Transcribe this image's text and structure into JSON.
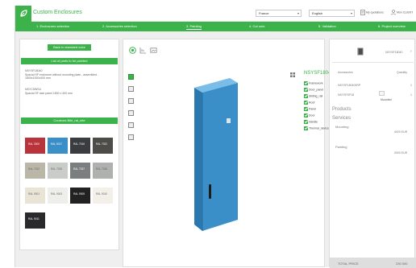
{
  "header": {
    "title": "Custom Enclosures",
    "country": "France",
    "language": "English",
    "quotations": "My quotations",
    "user": "Mon CLIENT"
  },
  "steps": [
    {
      "label": "1. Enclosures selection",
      "active": false
    },
    {
      "label": "2. Accessories selection",
      "active": false
    },
    {
      "label": "3. Painting",
      "active": true
    },
    {
      "label": "4. Cut outs",
      "active": false
    },
    {
      "label": "5. Validation",
      "active": false
    },
    {
      "label": "6. Project overview",
      "active": false
    }
  ],
  "left_panel": {
    "back_button": "Back to standard color",
    "parts_header": "List of parts to be painted",
    "items": [
      {
        "code": "NSYSF18040",
        "desc": "Spacial SF enclosure without mounting plate - assembled - 1800x1000x400 mm"
      },
      {
        "code": "NSYCSWS4",
        "desc": "Spacial SF side panel 1800 x 400 mm"
      }
    ],
    "colors_header": "Couleurs Bibl_ral_nite",
    "swatches": [
      {
        "label": "RAL 3000",
        "color": "#b8333b"
      },
      {
        "label": "RAL 5017",
        "color": "#3a8fc8"
      },
      {
        "label": "RAL 7016",
        "color": "#3a3d40"
      },
      {
        "label": "RAL 7022",
        "color": "#4d4c49"
      },
      {
        "label": "RAL 7032",
        "color": "#bbb7a8"
      },
      {
        "label": "RAL 7035",
        "color": "#c9ccc9"
      },
      {
        "label": "RAL 7037",
        "color": "#7c7f80"
      },
      {
        "label": "RAL 7038",
        "color": "#aeb1ae"
      },
      {
        "label": "RAL 9001",
        "color": "#e9e4d6"
      },
      {
        "label": "RAL 9003",
        "color": "#eeeeea"
      },
      {
        "label": "RAL 9005",
        "color": "#222222"
      },
      {
        "label": "RAL 9010",
        "color": "#f2f0e9"
      },
      {
        "label": "RAL 9011",
        "color": "#2a2a2c"
      }
    ]
  },
  "viewer": {
    "enclosure_code": "NSYSF18040",
    "parts": [
      "Framework",
      "Door_panel",
      "Sliding_rail",
      "Roof",
      "Panel",
      "Door",
      "Handle",
      "Thermal_device"
    ]
  },
  "right_panel": {
    "product_code": "NSYSF18040",
    "accessories_label": "Accessories",
    "quantity_label": "Quantity",
    "lines": [
      {
        "code": "NSYSF180400RP",
        "qty": "1"
      },
      {
        "code": "NSYSFSP18",
        "qty": "1"
      }
    ],
    "mounted_label": "Mounted",
    "products_label": "Products",
    "services_label": "Services",
    "mounting_label": "Mounting",
    "mounting_value": "4020 EUR",
    "painting_label": "Painting",
    "painting_value": "0000 EUR",
    "total_label": "TOTAL PRICE",
    "total_value": "230 000"
  },
  "colors": {
    "accent": "#3cb24a",
    "enclosure_blue": "#3a8fc8"
  }
}
